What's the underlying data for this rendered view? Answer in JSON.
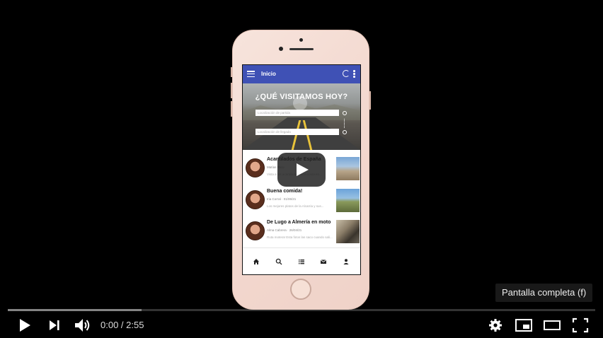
{
  "app": {
    "title": "Inicio",
    "hero_heading": "¿QUÉ VISITAMOS HOY?",
    "origin_placeholder": "Localización de partida",
    "destination_placeholder": "Localización de llegada",
    "posts": [
      {
        "title": "Acantilados de España",
        "meta": "Matías Ricci",
        "desc": "Vista a los acantilados de la costa en..."
      },
      {
        "title": "Buena comida!",
        "meta": "Iria Corral · 01/06/21",
        "desc": "Los mejores platos de la Alcarria y sus..."
      },
      {
        "title": "De Lugo a Almería en moto",
        "meta": "Alma Cabrera · 26/04/21",
        "desc": "Ruta motera! Esta fotos las saco cuando sali..."
      }
    ],
    "nav": [
      "home-icon",
      "search-icon",
      "list-icon",
      "mail-icon",
      "person-icon"
    ]
  },
  "player": {
    "current_time": "0:00",
    "separator": " / ",
    "duration": "2:55",
    "tooltip": "Pantalla completa (f)",
    "loaded_fraction": 0.228
  },
  "colors": {
    "app_bar": "#3f51b5",
    "progress_bg": "#5a5a5a"
  }
}
